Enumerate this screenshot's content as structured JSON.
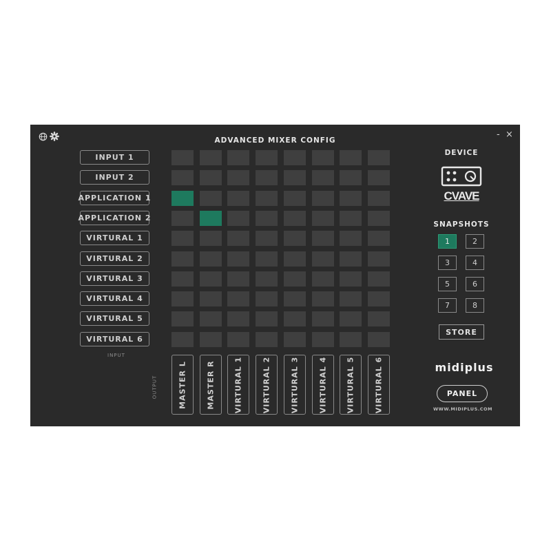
{
  "window": {
    "title": "ADVANCED MIXER CONFIG",
    "minimize_label": "-",
    "close_label": "×"
  },
  "toolbar_icons": [
    "globe-icon",
    "gear-icon"
  ],
  "inputs": [
    "INPUT 1",
    "INPUT 2",
    "APPLICATION 1",
    "APPLICATION 2",
    "VIRTURAL 1",
    "VIRTURAL 2",
    "VIRTURAL 3",
    "VIRTURAL 4",
    "VIRTURAL 5",
    "VIRTURAL 6"
  ],
  "input_caption": "INPUT",
  "output_caption": "OUTPUT",
  "outputs": [
    "MASTER L",
    "MASTER R",
    "VIRTURAL 1",
    "VIRTURAL 2",
    "VIRTURAL 3",
    "VIRTURAL 4",
    "VIRTURAL 5",
    "VIRTURAL 6"
  ],
  "matrix_active": [
    [
      2,
      0
    ],
    [
      3,
      1
    ]
  ],
  "device": {
    "label": "DEVICE",
    "logo_text": "CVAVE"
  },
  "snapshots": {
    "label": "SNAPSHOTS",
    "items": [
      "1",
      "2",
      "3",
      "4",
      "5",
      "6",
      "7",
      "8"
    ],
    "selected": "1",
    "store_label": "STORE"
  },
  "brand": {
    "name": "midiplus",
    "panel_label": "PANEL",
    "website": "WWW.MIDIPLUS.COM"
  },
  "colors": {
    "background": "#2a2a2a",
    "cell": "#3f3f3f",
    "active": "#1e7a5e"
  }
}
